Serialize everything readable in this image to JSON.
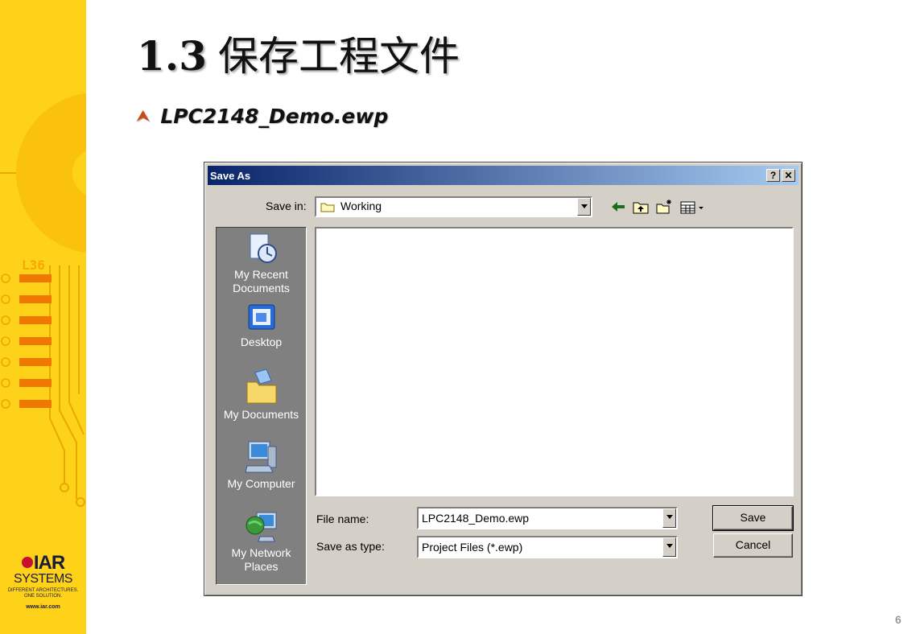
{
  "slide": {
    "title_num": "1.3",
    "title_text": "保存工程文件",
    "bullet": "LPC2148_Demo.ewp",
    "page_number": "6"
  },
  "logo": {
    "brand": "IAR",
    "systems": "SYSTEMS",
    "tagline1": "DIFFERENT ARCHITECTURES.",
    "tagline2": "ONE SOLUTION.",
    "url": "www.iar.com",
    "chip_label": "L36"
  },
  "dialog": {
    "title": "Save As",
    "help_button": "?",
    "close_button": "✕",
    "save_in_label": "Save in:",
    "save_in_value": "Working",
    "places": [
      {
        "label1": "My Recent",
        "label2": "Documents",
        "icon": "recent-documents-icon"
      },
      {
        "label1": "Desktop",
        "label2": "",
        "icon": "desktop-icon"
      },
      {
        "label1": "My Documents",
        "label2": "",
        "icon": "my-documents-icon"
      },
      {
        "label1": "My Computer",
        "label2": "",
        "icon": "my-computer-icon"
      },
      {
        "label1": "My Network",
        "label2": "Places",
        "icon": "network-places-icon"
      }
    ],
    "file_name_label": "File name:",
    "file_name_value": "LPC2148_Demo.ewp",
    "save_as_type_label": "Save as type:",
    "save_as_type_value": "Project Files (*.ewp)",
    "save_button": "Save",
    "cancel_button": "Cancel"
  },
  "colors": {
    "band": "#ffd21a",
    "titlebar_start": "#0a246a",
    "titlebar_end": "#a6caf0",
    "dialog_face": "#d4d0c8"
  }
}
